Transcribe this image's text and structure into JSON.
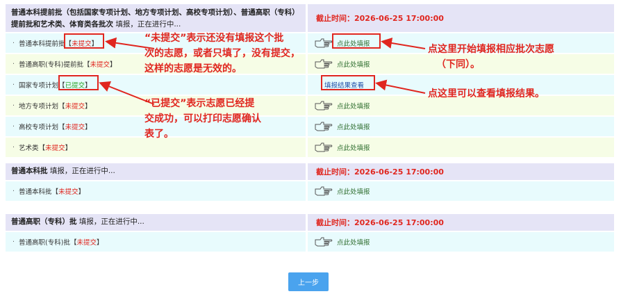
{
  "sections": [
    {
      "title_bold": "普通本科提前批（包括国家专项计划、地方专项计划、高校专项计划）、普通高职（专科）提前批和艺术类、体育类各批次",
      "title_rest": "填报，正在进行中...",
      "deadline": "截止时间：2026-06-25 17:00:00",
      "rows": [
        {
          "name": "普通本科提前批",
          "status": "未提交",
          "action": "点此处填报"
        },
        {
          "name": "普通高职(专科)提前批",
          "status": "未提交",
          "action": "点此处填报"
        },
        {
          "name": "国家专项计划",
          "status": "已提交",
          "action": "填报结果查看"
        },
        {
          "name": "地方专项计划",
          "status": "未提交",
          "action": "点此处填报"
        },
        {
          "name": "高校专项计划",
          "status": "未提交",
          "action": "点此处填报"
        },
        {
          "name": "艺术类",
          "status": "未提交",
          "action": "点此处填报"
        }
      ]
    },
    {
      "title_bold": "普通本科批",
      "title_rest": "填报，正在进行中...",
      "deadline": "截止时间：2026-06-25 17:00:00",
      "rows": [
        {
          "name": "普通本科批",
          "status": "未提交",
          "action": "点此处填报"
        }
      ]
    },
    {
      "title_bold": "普通高职（专科）批",
      "title_rest": "填报，正在进行中...",
      "deadline": "截止时间：2026-06-25 17:00:00",
      "rows": [
        {
          "name": "普通高职(专科)批",
          "status": "未提交",
          "action": "点此处填报"
        }
      ]
    }
  ],
  "bracket_open": "【",
  "bracket_close": "】",
  "dot": "·",
  "annotations": {
    "not_submitted_1": "“未提交”表示还没有填报这个批",
    "not_submitted_2": "次的志愿，或者只填了，没有提交，",
    "not_submitted_3": "这样的志愿是无效的。",
    "submitted_1": "“已提交”表示志愿已经提",
    "submitted_2": "交成功，可以打印志愿确认",
    "submitted_3": "表了。",
    "click_fill_1": "点这里开始填报相应批次志愿",
    "click_fill_2": "（下同）。",
    "click_view": "点这里可以查看填报结果。"
  },
  "buttons": {
    "prev": "上一步"
  },
  "colors": {
    "header": "#e5e4f6",
    "row_a": "#e8fbfd",
    "row_b": "#f6fde6",
    "alert": "#e0261f",
    "button": "#4aa3ee"
  }
}
